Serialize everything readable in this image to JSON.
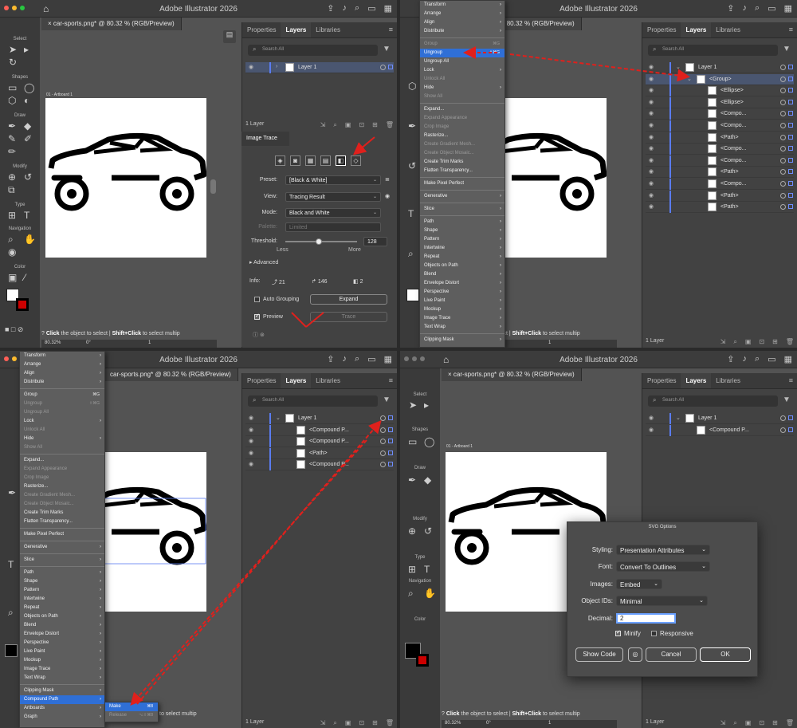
{
  "app_title": "Adobe Illustrator 2026",
  "doc_tab": "car-sports.png* @ 80.32 % (RGB/Preview)",
  "artboard_label": "01 - Artboard 1",
  "panel_tabs": [
    "Properties",
    "Layers",
    "Libraries"
  ],
  "search_placeholder": "Search All",
  "tool_sections": {
    "select": "Select",
    "shapes": "Shapes",
    "draw": "Draw",
    "modify": "Modify",
    "type": "Type",
    "navigation": "Navigation",
    "color": "Color"
  },
  "status": {
    "bold1": "Click",
    "text1": "the object to select",
    "bold2": "Shift+Click",
    "text2": "to select multip",
    "zoom": "80.32%",
    "rotation": "0°",
    "page": "1"
  },
  "layer_count": "1 Layer",
  "q1": {
    "layer_name": "Layer 1",
    "image_trace": {
      "title": "Image Trace",
      "preset_label": "Preset:",
      "preset": "[Black & White]",
      "view_label": "View:",
      "view": "Tracing Result",
      "mode_label": "Mode:",
      "mode": "Black and White",
      "palette_label": "Palette:",
      "palette": "Limited",
      "threshold_label": "Threshold:",
      "threshold": "128",
      "less": "Less",
      "more": "More",
      "advanced": "Advanced",
      "info_label": "Info:",
      "paths": "21",
      "anchors": "146",
      "colors": "2",
      "auto_grouping": "Auto Grouping",
      "expand": "Expand",
      "preview": "Preview",
      "trace": "Trace"
    }
  },
  "q2": {
    "menu": [
      {
        "label": "Transform",
        "arrow": true
      },
      {
        "label": "Arrange",
        "arrow": true
      },
      {
        "label": "Align",
        "arrow": true
      },
      {
        "label": "Distribute",
        "arrow": true
      },
      {
        "sep": true
      },
      {
        "label": "Group",
        "shortcut": "⌘G",
        "disabled": true
      },
      {
        "label": "Ungroup",
        "shortcut": "⇧⌘G",
        "highlight": true
      },
      {
        "label": "Ungroup All"
      },
      {
        "label": "Lock",
        "arrow": true
      },
      {
        "label": "Unlock All",
        "disabled": true
      },
      {
        "label": "Hide",
        "arrow": true
      },
      {
        "label": "Show All",
        "disabled": true
      },
      {
        "sep": true
      },
      {
        "label": "Expand..."
      },
      {
        "label": "Expand Appearance",
        "disabled": true
      },
      {
        "label": "Crop Image",
        "disabled": true
      },
      {
        "label": "Rasterize..."
      },
      {
        "label": "Create Gradient Mesh...",
        "disabled": true
      },
      {
        "label": "Create Object Mosaic...",
        "disabled": true
      },
      {
        "label": "Create Trim Marks"
      },
      {
        "label": "Flatten Transparency..."
      },
      {
        "sep": true
      },
      {
        "label": "Make Pixel Perfect"
      },
      {
        "sep": true
      },
      {
        "label": "Generative",
        "arrow": true
      },
      {
        "sep": true
      },
      {
        "label": "Slice",
        "arrow": true
      },
      {
        "sep": true
      },
      {
        "label": "Path",
        "arrow": true
      },
      {
        "label": "Shape",
        "arrow": true
      },
      {
        "label": "Pattern",
        "arrow": true
      },
      {
        "label": "Intertwine",
        "arrow": true
      },
      {
        "label": "Repeat",
        "arrow": true
      },
      {
        "label": "Objects on Path",
        "arrow": true
      },
      {
        "label": "Blend",
        "arrow": true
      },
      {
        "label": "Envelope Distort",
        "arrow": true
      },
      {
        "label": "Perspective",
        "arrow": true
      },
      {
        "label": "Live Paint",
        "arrow": true
      },
      {
        "label": "Mockup",
        "arrow": true
      },
      {
        "label": "Image Trace",
        "arrow": true
      },
      {
        "label": "Text Wrap",
        "arrow": true
      },
      {
        "sep": true
      },
      {
        "label": "Clipping Mask",
        "arrow": true
      }
    ],
    "layers": [
      {
        "name": "Layer 1",
        "depth": 0,
        "chev": "⌄"
      },
      {
        "name": "<Group>",
        "depth": 1,
        "chev": "⌄",
        "sel": true
      },
      {
        "name": "<Ellipse>",
        "depth": 2
      },
      {
        "name": "<Ellipse>",
        "depth": 2
      },
      {
        "name": "<Compo...",
        "depth": 2
      },
      {
        "name": "<Compo...",
        "depth": 2
      },
      {
        "name": "<Path>",
        "depth": 2
      },
      {
        "name": "<Compo...",
        "depth": 2
      },
      {
        "name": "<Compo...",
        "depth": 2
      },
      {
        "name": "<Path>",
        "depth": 2
      },
      {
        "name": "<Compo...",
        "depth": 2
      },
      {
        "name": "<Path>",
        "depth": 2
      },
      {
        "name": "<Path>",
        "depth": 2
      }
    ]
  },
  "q3": {
    "menu": [
      {
        "label": "Transform",
        "arrow": true
      },
      {
        "label": "Arrange",
        "arrow": true
      },
      {
        "label": "Align",
        "arrow": true
      },
      {
        "label": "Distribute",
        "arrow": true
      },
      {
        "sep": true
      },
      {
        "label": "Group",
        "shortcut": "⌘G"
      },
      {
        "label": "Ungroup",
        "shortcut": "⇧⌘G",
        "disabled": true
      },
      {
        "label": "Ungroup All",
        "disabled": true
      },
      {
        "label": "Lock",
        "arrow": true
      },
      {
        "label": "Unlock All",
        "disabled": true
      },
      {
        "label": "Hide",
        "arrow": true
      },
      {
        "label": "Show All",
        "disabled": true
      },
      {
        "sep": true
      },
      {
        "label": "Expand..."
      },
      {
        "label": "Expand Appearance",
        "disabled": true
      },
      {
        "label": "Crop Image",
        "disabled": true
      },
      {
        "label": "Rasterize..."
      },
      {
        "label": "Create Gradient Mesh...",
        "disabled": true
      },
      {
        "label": "Create Object Mosaic...",
        "disabled": true
      },
      {
        "label": "Create Trim Marks"
      },
      {
        "label": "Flatten Transparency..."
      },
      {
        "sep": true
      },
      {
        "label": "Make Pixel Perfect"
      },
      {
        "sep": true
      },
      {
        "label": "Generative",
        "arrow": true
      },
      {
        "sep": true
      },
      {
        "label": "Slice",
        "arrow": true
      },
      {
        "sep": true
      },
      {
        "label": "Path",
        "arrow": true
      },
      {
        "label": "Shape",
        "arrow": true
      },
      {
        "label": "Pattern",
        "arrow": true
      },
      {
        "label": "Intertwine",
        "arrow": true
      },
      {
        "label": "Repeat",
        "arrow": true
      },
      {
        "label": "Objects on Path",
        "arrow": true
      },
      {
        "label": "Blend",
        "arrow": true
      },
      {
        "label": "Envelope Distort",
        "arrow": true
      },
      {
        "label": "Perspective",
        "arrow": true
      },
      {
        "label": "Live Paint",
        "arrow": true
      },
      {
        "label": "Mockup",
        "arrow": true
      },
      {
        "label": "Image Trace",
        "arrow": true
      },
      {
        "label": "Text Wrap",
        "arrow": true
      },
      {
        "sep": true
      },
      {
        "label": "Clipping Mask",
        "arrow": true
      },
      {
        "label": "Compound Path",
        "arrow": true,
        "highlight": true
      },
      {
        "label": "Artboards",
        "arrow": true
      },
      {
        "label": "Graph",
        "arrow": true
      }
    ],
    "submenu": [
      {
        "label": "Make",
        "shortcut": "⌘8",
        "highlight": true
      },
      {
        "label": "Release",
        "shortcut": "⌥⇧⌘8",
        "disabled": true
      }
    ],
    "layers": [
      {
        "name": "Layer 1",
        "depth": 0,
        "chev": "⌄"
      },
      {
        "name": "<Compound P...",
        "depth": 1
      },
      {
        "name": "<Compound P...",
        "depth": 1
      },
      {
        "name": "<Path>",
        "depth": 1
      },
      {
        "name": "<Compound P...",
        "depth": 1
      }
    ]
  },
  "q4": {
    "layers": [
      {
        "name": "Layer 1",
        "depth": 0,
        "chev": "⌄"
      },
      {
        "name": "<Compound P...",
        "depth": 1
      }
    ],
    "svg_options": {
      "title": "SVG Options",
      "styling_label": "Styling:",
      "styling": "Presentation Attributes",
      "font_label": "Font:",
      "font": "Convert To Outlines",
      "images_label": "Images:",
      "images": "Embed",
      "ids_label": "Object IDs:",
      "ids": "Minimal",
      "decimal_label": "Decimal:",
      "decimal": "2",
      "minify": "Minify",
      "responsive": "Responsive",
      "show_code": "Show Code",
      "cancel": "Cancel",
      "ok": "OK"
    }
  },
  "colors": {
    "highlight": "#2f6fd6",
    "arrow": "#e0201c",
    "layer_bar": "#5a7cf0"
  }
}
